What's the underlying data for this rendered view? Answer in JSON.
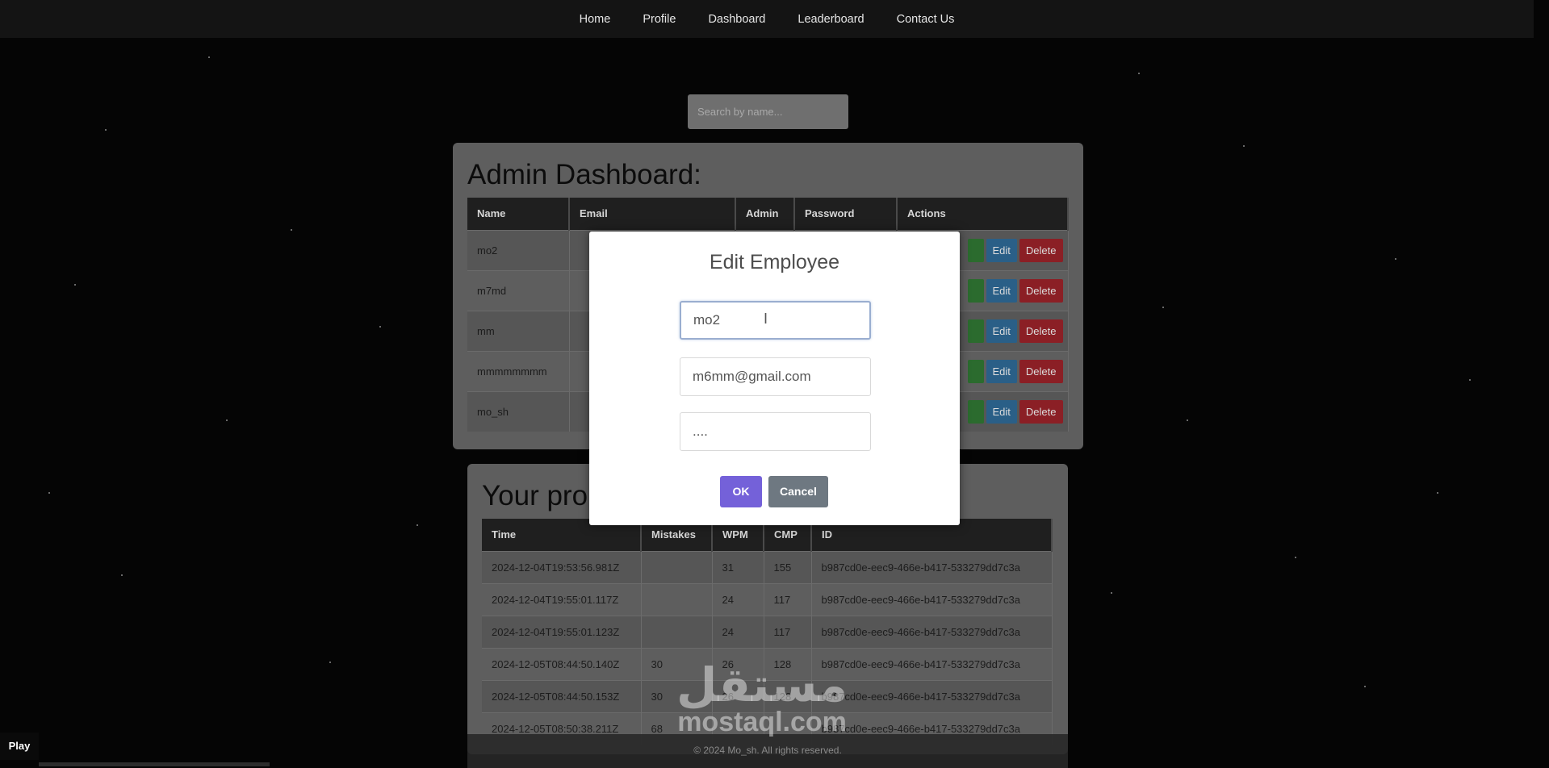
{
  "nav": {
    "items": [
      "Home",
      "Profile",
      "Dashboard",
      "Leaderboard",
      "Contact Us"
    ]
  },
  "search": {
    "placeholder": "Search by name..."
  },
  "admin_dashboard": {
    "title": "Admin Dashboard:",
    "columns": [
      "Name",
      "Email",
      "Admin",
      "Password",
      "Actions"
    ],
    "rows": [
      {
        "name": "mo2"
      },
      {
        "name": "m7md"
      },
      {
        "name": "mm"
      },
      {
        "name": "mmmmmmmm"
      },
      {
        "name": "mo_sh"
      }
    ],
    "actions": {
      "edit": "Edit",
      "delete": "Delete"
    }
  },
  "progress": {
    "title": "Your pro",
    "columns": [
      "Time",
      "Mistakes",
      "WPM",
      "CMP",
      "ID"
    ],
    "rows": [
      {
        "time": "2024-12-04T19:53:56.981Z",
        "mistakes": "",
        "wpm": "31",
        "cmp": "155",
        "id": "b987cd0e-eec9-466e-b417-533279dd7c3a"
      },
      {
        "time": "2024-12-04T19:55:01.117Z",
        "mistakes": "",
        "wpm": "24",
        "cmp": "117",
        "id": "b987cd0e-eec9-466e-b417-533279dd7c3a"
      },
      {
        "time": "2024-12-04T19:55:01.123Z",
        "mistakes": "",
        "wpm": "24",
        "cmp": "117",
        "id": "b987cd0e-eec9-466e-b417-533279dd7c3a"
      },
      {
        "time": "2024-12-05T08:44:50.140Z",
        "mistakes": "30",
        "wpm": "26",
        "cmp": "128",
        "id": "b987cd0e-eec9-466e-b417-533279dd7c3a"
      },
      {
        "time": "2024-12-05T08:44:50.153Z",
        "mistakes": "30",
        "wpm": "26",
        "cmp": "128",
        "id": "b987cd0e-eec9-466e-b417-533279dd7c3a"
      },
      {
        "time": "2024-12-05T08:50:38.211Z",
        "mistakes": "68",
        "wpm": "",
        "cmp": "",
        "id": "b987cd0e-eec9-466e-b417-533279dd7c3a"
      }
    ]
  },
  "modal": {
    "title": "Edit Employee",
    "name_value": "mo2",
    "email_value": "m6mm@gmail.com",
    "password_value": "....",
    "ok_label": "OK",
    "cancel_label": "Cancel"
  },
  "footer": {
    "text": "© 2024 Mo_sh. All rights reserved."
  },
  "watermark": {
    "arabic": "مستقل",
    "latin": "mostaql.com"
  },
  "player": {
    "play_label": "Play"
  }
}
